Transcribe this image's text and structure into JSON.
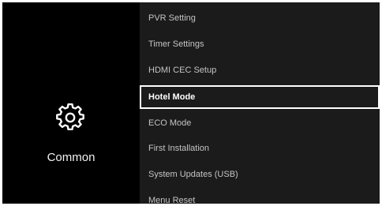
{
  "category": {
    "label": "Common",
    "icon": "gear-icon"
  },
  "menu": {
    "items": [
      {
        "label": "PVR Setting",
        "selected": false
      },
      {
        "label": "Timer Settings",
        "selected": false
      },
      {
        "label": "HDMI CEC Setup",
        "selected": false
      },
      {
        "label": "Hotel Mode",
        "selected": true
      },
      {
        "label": "ECO Mode",
        "selected": false
      },
      {
        "label": "First Installation",
        "selected": false
      },
      {
        "label": "System Updates (USB)",
        "selected": false
      },
      {
        "label": "Menu Reset",
        "selected": false
      }
    ]
  },
  "colors": {
    "background": "#000000",
    "menu_background": "#1b1b1b",
    "text": "#c4c4c4",
    "selected_text": "#ffffff",
    "selected_border": "#ffffff"
  }
}
